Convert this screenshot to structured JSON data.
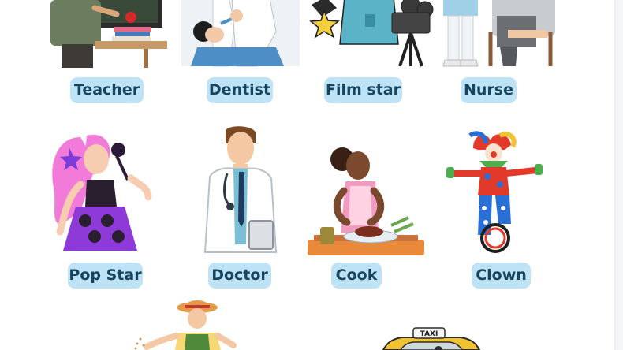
{
  "labels": {
    "teacher": "Teacher",
    "dentist": "Dentist",
    "film_star": "Film star",
    "nurse": "Nurse",
    "pop_star": "Pop Star",
    "doctor": "Doctor",
    "cook": "Cook",
    "clown": "Clown"
  },
  "taxi_sign_text": "TAXI",
  "colors": {
    "label_bg": "#bfe3f6",
    "label_text": "#16455d"
  },
  "icons": [
    "teacher-illustration",
    "dentist-illustration",
    "film-star-illustration",
    "nurse-illustration",
    "pop-star-illustration",
    "doctor-illustration",
    "cook-illustration",
    "clown-illustration",
    "farmer-illustration",
    "taxi-illustration"
  ]
}
